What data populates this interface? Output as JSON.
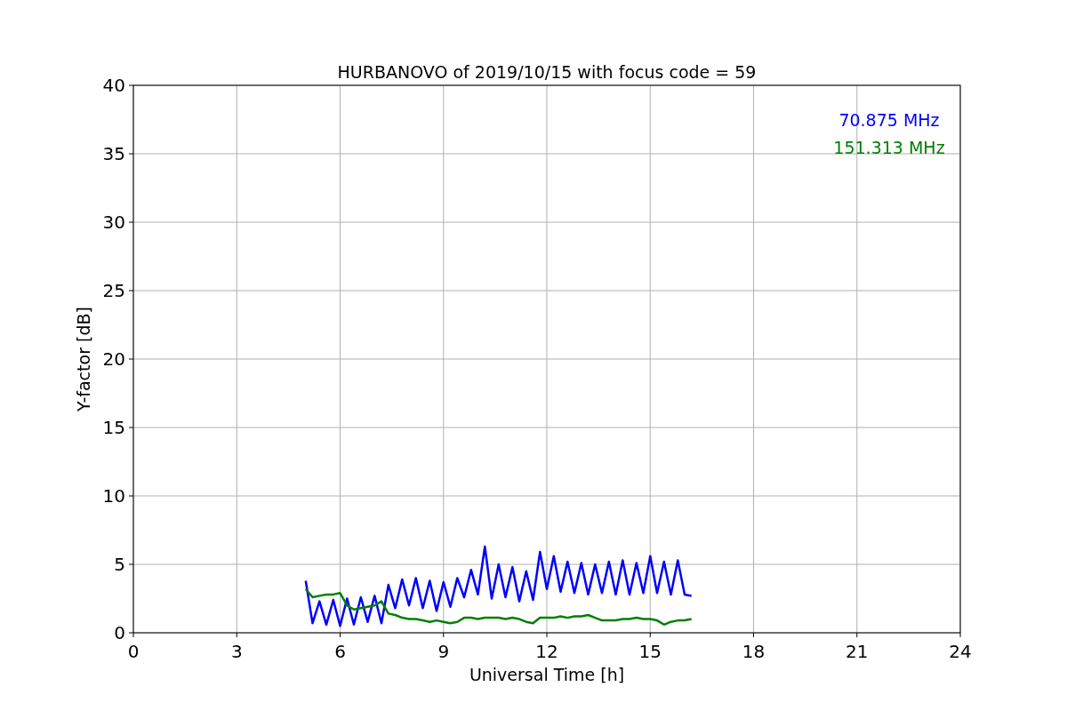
{
  "chart_data": {
    "type": "line",
    "title": "HURBANOVO of 2019/10/15 with focus code = 59",
    "xlabel": "Universal Time [h]",
    "ylabel": "Y-factor [dB]",
    "x": [
      5.0,
      5.2,
      5.4,
      5.6,
      5.8,
      6.0,
      6.2,
      6.4,
      6.6,
      6.8,
      7.0,
      7.2,
      7.4,
      7.6,
      7.8,
      8.0,
      8.2,
      8.4,
      8.6,
      8.8,
      9.0,
      9.2,
      9.4,
      9.6,
      9.8,
      10.0,
      10.2,
      10.4,
      10.6,
      10.8,
      11.0,
      11.2,
      11.4,
      11.6,
      11.8,
      12.0,
      12.2,
      12.4,
      12.6,
      12.8,
      13.0,
      13.2,
      13.4,
      13.6,
      13.8,
      14.0,
      14.2,
      14.4,
      14.6,
      14.8,
      15.0,
      15.2,
      15.4,
      15.6,
      15.8,
      16.0,
      16.2
    ],
    "series": [
      {
        "name": "70.875 MHz",
        "color": "#0000ff",
        "values": [
          3.8,
          0.7,
          2.3,
          0.6,
          2.4,
          0.5,
          2.5,
          0.6,
          2.6,
          0.8,
          2.7,
          0.7,
          3.5,
          1.8,
          3.9,
          2.0,
          4.0,
          1.8,
          3.8,
          1.6,
          3.7,
          1.9,
          4.0,
          2.6,
          4.6,
          2.8,
          6.3,
          2.5,
          5.0,
          2.6,
          4.8,
          2.3,
          4.5,
          2.4,
          5.9,
          3.2,
          5.6,
          3.0,
          5.2,
          2.9,
          5.1,
          2.8,
          5.0,
          2.9,
          5.2,
          2.8,
          5.3,
          2.8,
          5.1,
          2.9,
          5.6,
          2.9,
          5.2,
          2.8,
          5.3,
          2.8,
          2.7
        ]
      },
      {
        "name": "151.313 MHz",
        "color": "#008000",
        "values": [
          3.2,
          2.6,
          2.7,
          2.8,
          2.8,
          2.9,
          2.0,
          1.7,
          1.8,
          1.9,
          2.0,
          2.3,
          1.4,
          1.3,
          1.1,
          1.0,
          1.0,
          0.9,
          0.8,
          0.9,
          0.8,
          0.7,
          0.8,
          1.1,
          1.1,
          1.0,
          1.1,
          1.1,
          1.1,
          1.0,
          1.1,
          1.0,
          0.8,
          0.7,
          1.1,
          1.1,
          1.1,
          1.2,
          1.1,
          1.2,
          1.2,
          1.3,
          1.1,
          0.9,
          0.9,
          0.9,
          1.0,
          1.0,
          1.1,
          1.0,
          1.0,
          0.9,
          0.6,
          0.8,
          0.9,
          0.9,
          1.0
        ]
      }
    ],
    "xlim": [
      0,
      24
    ],
    "ylim": [
      0,
      40
    ],
    "xticks": [
      0,
      3,
      6,
      9,
      12,
      15,
      18,
      21,
      24
    ],
    "yticks": [
      0,
      5,
      10,
      15,
      20,
      25,
      30,
      35,
      40
    ],
    "grid": true
  }
}
